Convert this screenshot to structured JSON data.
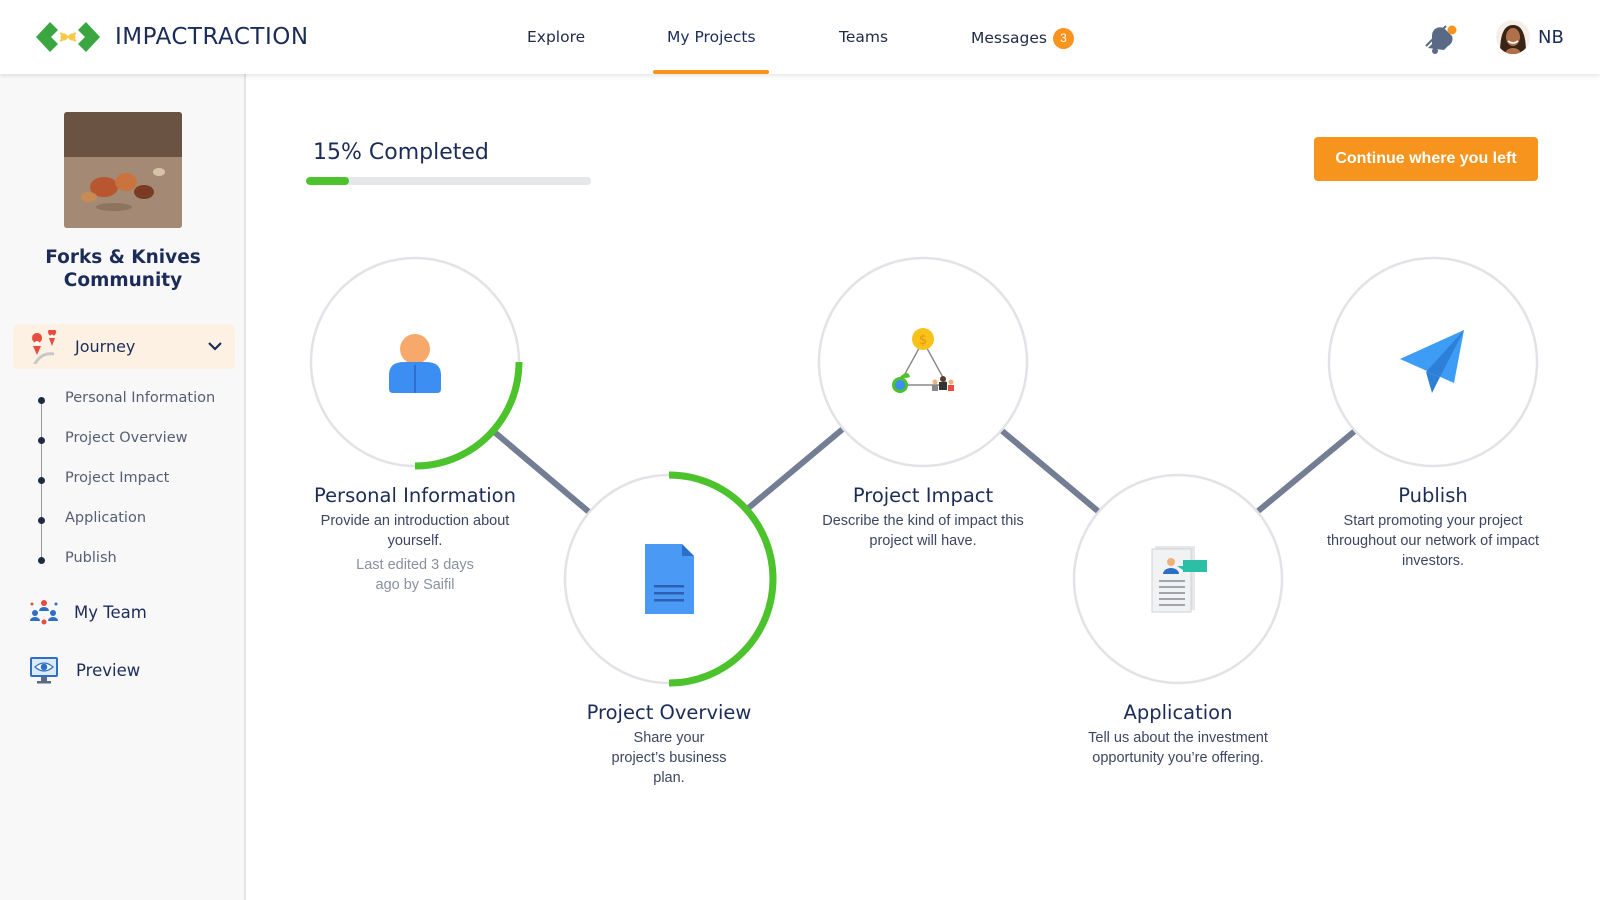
{
  "app": {
    "brand": "IMPACTRACTION",
    "colors": {
      "accent": "#f7941d",
      "progress": "#4cc22c",
      "navy": "#1c2c59",
      "connector": "#737d93"
    }
  },
  "nav": {
    "items": [
      {
        "label": "Explore"
      },
      {
        "label": "My Projects",
        "active": true
      },
      {
        "label": "Teams"
      },
      {
        "label": "Messages",
        "badge": "3"
      }
    ],
    "notification_icon": "bell-icon",
    "user_initials": "NB"
  },
  "sidebar": {
    "project_name": "Forks & Knives Community",
    "journey_label": "Journey",
    "journey_icon": "map-pin-icon",
    "steps": [
      {
        "label": "Personal Information"
      },
      {
        "label": "Project Overview"
      },
      {
        "label": "Project Impact"
      },
      {
        "label": "Application"
      },
      {
        "label": "Publish"
      }
    ],
    "links": [
      {
        "label": "My Team",
        "icon": "team-icon"
      },
      {
        "label": "Preview",
        "icon": "monitor-eye-icon"
      }
    ]
  },
  "main": {
    "progress_label": "15% Completed",
    "progress_fraction": 0.15,
    "continue_label": "Continue where you left",
    "steps": [
      {
        "title": "Personal Information",
        "desc": "Provide an introduction about yourself.",
        "meta": "Last edited 3 days ago by Saifil",
        "progress": 0.25,
        "icon": "user-icon"
      },
      {
        "title": "Project Overview",
        "desc": "Share your project’s business plan.",
        "progress": 0.5,
        "icon": "document-icon"
      },
      {
        "title": "Project Impact",
        "desc": "Describe the kind of impact this project will have.",
        "progress": 0,
        "icon": "impact-triangle-icon"
      },
      {
        "title": "Application",
        "desc": "Tell us about the investment opportunity you’re offering.",
        "progress": 0,
        "icon": "application-form-icon"
      },
      {
        "title": "Publish",
        "desc": "Start promoting your project throughout our network of impact investors.",
        "progress": 0,
        "icon": "paper-plane-icon"
      }
    ]
  }
}
